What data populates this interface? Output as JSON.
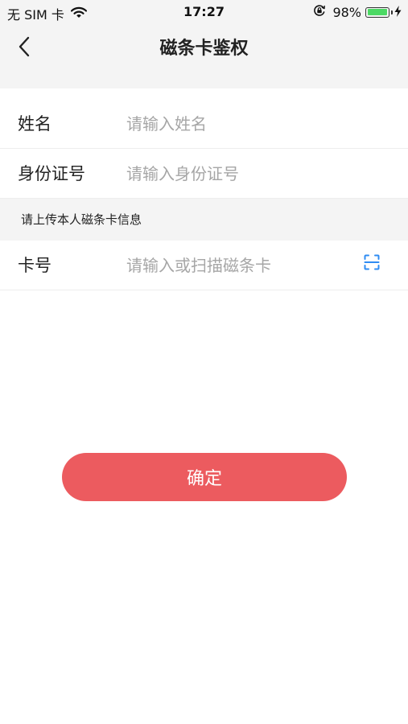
{
  "status_bar": {
    "carrier": "无 SIM 卡",
    "time": "17:27",
    "battery_percent": "98%",
    "battery_level": 0.98,
    "battery_color": "#4cd964"
  },
  "nav": {
    "back_icon": "chevron-left-icon",
    "title": "磁条卡鉴权"
  },
  "form": {
    "name": {
      "label": "姓名",
      "placeholder": "请输入姓名",
      "value": ""
    },
    "id_number": {
      "label": "身份证号",
      "placeholder": "请输入身份证号",
      "value": ""
    },
    "section_title": "请上传本人磁条卡信息",
    "card_number": {
      "label": "卡号",
      "placeholder": "请输入或扫描磁条卡",
      "value": "",
      "scan_icon": "scan-icon"
    }
  },
  "confirm": {
    "label": "确定",
    "color": "#ec5b5f"
  },
  "colors": {
    "header_background": "#f4f4f4",
    "accent_blue": "#2f8cf3"
  }
}
